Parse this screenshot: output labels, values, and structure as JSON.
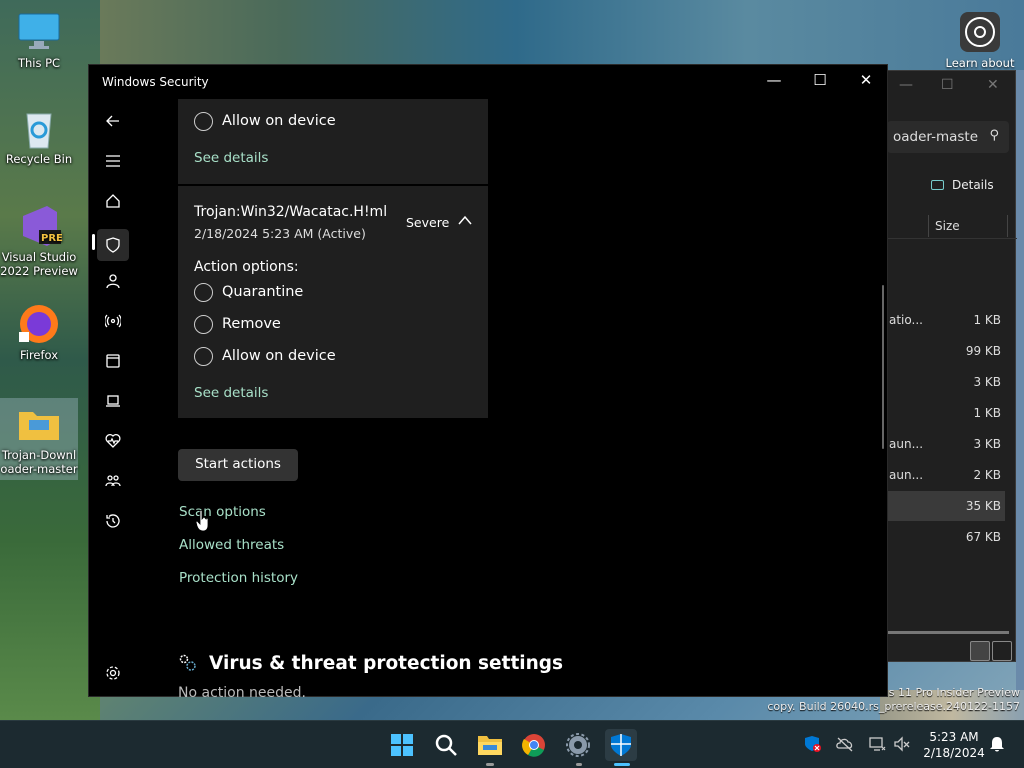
{
  "desktop": {
    "icons": [
      {
        "label": "This PC"
      },
      {
        "label": "Recycle Bin"
      },
      {
        "label": "Visual Studio 2022 Preview",
        "badge": "PRE"
      },
      {
        "label": "Firefox"
      },
      {
        "label": "Trojan-Downloader-master",
        "line1": "Trojan-Downl",
        "line2": "oader-master"
      }
    ],
    "learn_about": "Learn about",
    "build_line1": "s 11 Pro Insider Preview",
    "build_line2": "copy. Build 26040.rs_prerelease.240122-1157"
  },
  "explorer": {
    "search_text": "oader-maste",
    "details_label": "Details",
    "size_header": "Size",
    "rows": [
      {
        "name": "atio...",
        "size": "1 KB"
      },
      {
        "name": "",
        "size": "99 KB"
      },
      {
        "name": "",
        "size": "3 KB"
      },
      {
        "name": "",
        "size": "1 KB"
      },
      {
        "name": "aun...",
        "size": "3 KB"
      },
      {
        "name": "aun...",
        "size": "2 KB"
      },
      {
        "name": "",
        "size": "35 KB"
      },
      {
        "name": "",
        "size": "67 KB"
      }
    ]
  },
  "security": {
    "title": "Windows Security",
    "card1": {
      "option": "Allow on device",
      "details": "See details"
    },
    "card2": {
      "threat": "Trojan:Win32/Wacatac.H!ml",
      "date": "2/18/2024 5:23 AM (Active)",
      "severity": "Severe",
      "actions_label": "Action options:",
      "options": [
        "Quarantine",
        "Remove",
        "Allow on device"
      ],
      "details": "See details"
    },
    "start_actions": "Start actions",
    "links": [
      "Scan options",
      "Allowed threats",
      "Protection history"
    ],
    "settings_heading": "Virus & threat protection settings",
    "settings_sub": "No action needed."
  },
  "taskbar": {
    "time": "5:23 AM",
    "date": "2/18/2024"
  },
  "colors": {
    "link": "#a8e0c8",
    "card": "#1f1f1f",
    "accent": "#0078d4"
  }
}
